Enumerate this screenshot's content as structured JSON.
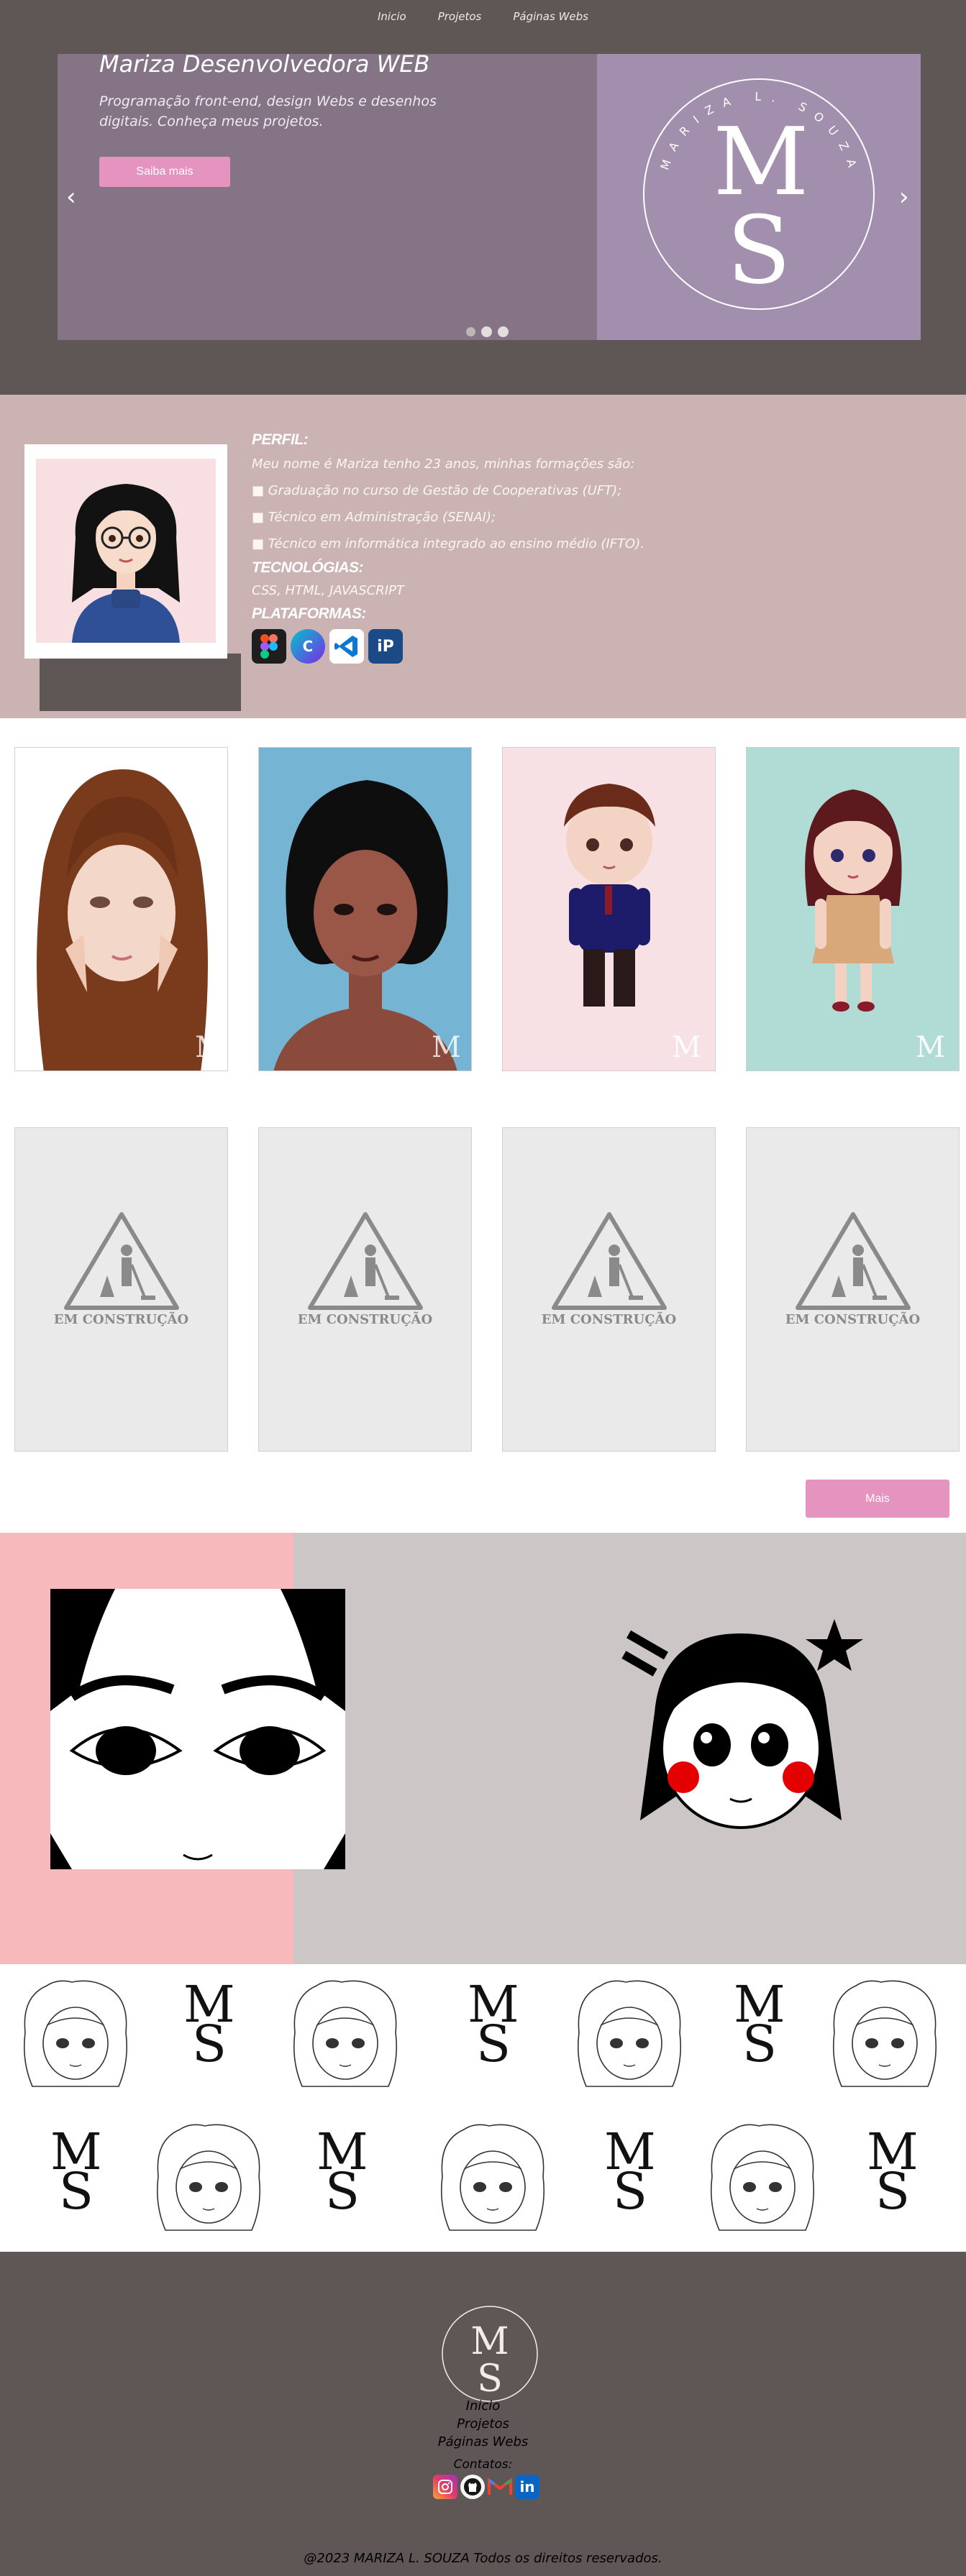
{
  "nav": {
    "items": [
      "Inicio",
      "Projetos",
      "Páginas Webs"
    ]
  },
  "hero": {
    "title": "Mariza Desenvolvedora WEB",
    "subtitle": "Programação front-end, design Webs e desenhos digitais. Conheça meus projetos.",
    "button": "Saiba mais",
    "prev": "‹",
    "next": "›",
    "logo_ring": "MARIZA L. SOUZA",
    "logo_m": "M",
    "logo_s": "S"
  },
  "profile": {
    "perfil_heading": "PERFIL:",
    "intro": "Meu nome é Mariza tenho 23 anos, minhas formações são:",
    "items": [
      "■ Graduação no curso de Gestão de Cooperativas (UFT);",
      "■ Técnico em Administração (SENAI);",
      "■ Técnico em informática integrado ao ensino médio (IFTO)."
    ],
    "tech_heading": "TECNOLÓGIAS:",
    "tech": "CSS, HTML, JAVASCRIPT",
    "platforms_heading": "PLATAFORMAS:",
    "platforms": [
      "figma-icon",
      "canva-icon",
      "vscode-icon",
      "ibispaint-icon"
    ]
  },
  "gallery": {
    "construction_label": "EM CONSTRUÇÃO",
    "more_button": "Mais"
  },
  "footer": {
    "links": [
      "Inicio",
      "Projetos",
      "Páginas Webs"
    ],
    "contacts_label": "Contatos:",
    "social": [
      "instagram-icon",
      "github-icon",
      "gmail-icon",
      "linkedin-icon"
    ],
    "copyright": "@2023 MARIZA L. SOUZA Todos os direitos reservados."
  },
  "colors": {
    "dark": "#5f5756",
    "purple": "#847486",
    "lavender": "#a28ead",
    "pink": "#e594bf",
    "rose": "#ccb3b3"
  }
}
